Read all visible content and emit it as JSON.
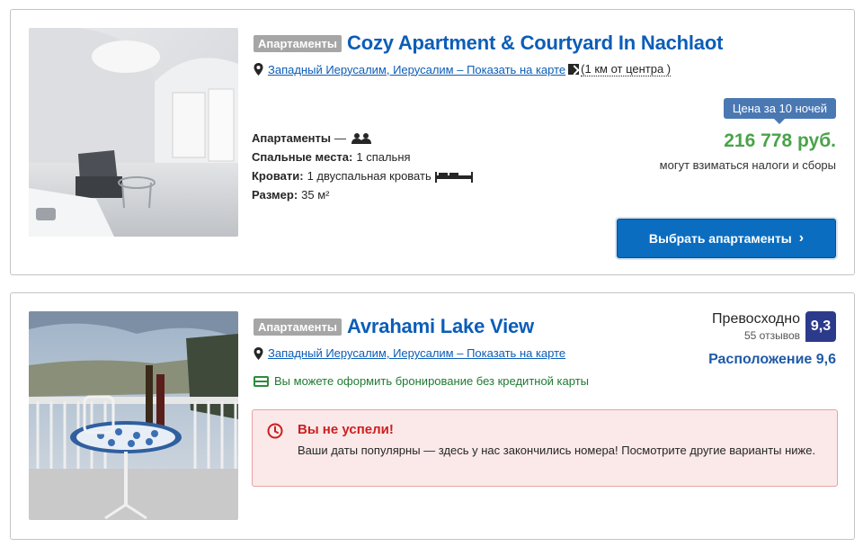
{
  "listings": [
    {
      "type_badge": "Апартаменты",
      "name": "Cozy Apartment & Courtyard In Nachlaot",
      "location_link": "Западный Иерусалим, Иерусалим – Показать на карте",
      "distance": "(1 км от центра )",
      "unit_type": "Апартаменты",
      "unit_dash": "—",
      "bedrooms_label": "Спальные места:",
      "bedrooms_value": "1 спальня",
      "beds_label": "Кровати:",
      "beds_value": "1 двуспальная кровать",
      "size_label": "Размер:",
      "size_value": "35 м²",
      "price_tag": "Цена за 10 ночей",
      "price": "216 778 руб.",
      "tax_note": "могут взиматься налоги и сборы",
      "select_button": "Выбрать апартаменты",
      "select_chevron": "›"
    },
    {
      "type_badge": "Апартаменты",
      "name": "Avrahami Lake View",
      "location_link": "Западный Иерусалим, Иерусалим – Показать на карте",
      "rating_word": "Превосходно",
      "review_count": "55 отзывов",
      "score": "9,3",
      "location_score": "Расположение 9,6",
      "no_card_text": "Вы можете оформить бронирование без кредитной карты",
      "alert_title": "Вы не успели!",
      "alert_message": "Ваши даты популярны — здесь у нас закончились номера! Посмотрите другие варианты ниже."
    }
  ],
  "icons": {
    "pin": "map-pin-icon",
    "people": "two-people-icon",
    "bed": "double-bed-icon",
    "card": "credit-card-icon",
    "clock": "clock-icon",
    "distance": "distance-arrow-icon"
  },
  "colors": {
    "link_blue": "#0c5db8",
    "price_green": "#4aa34a",
    "button_blue": "#0a6dc0",
    "score_navy": "#2c3a8c",
    "alert_red": "#cc1f1f",
    "alert_bg": "#fbe9e9",
    "badge_gray": "#a6a6a6",
    "no_card_green": "#1f7a32"
  }
}
